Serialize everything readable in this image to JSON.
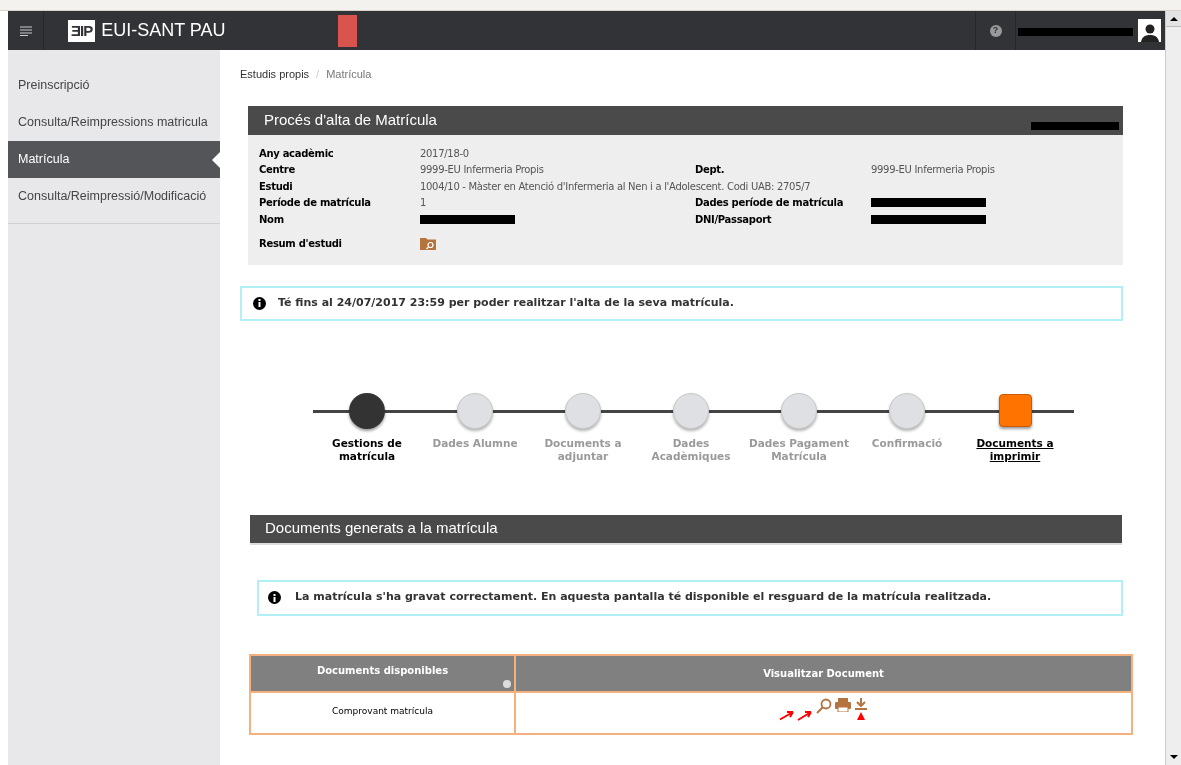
{
  "topbar": {
    "logo_mark": "ƎIP",
    "brand": "EUI-SANT PAU",
    "help": "?"
  },
  "sidebar": {
    "items": [
      {
        "label": "Preinscripció",
        "selected": false
      },
      {
        "label": "Consulta/Reimpressions matricula",
        "selected": false
      },
      {
        "label": "Matrícula",
        "selected": true
      },
      {
        "label": "Consulta/Reimpressió/Modificació",
        "selected": false
      }
    ]
  },
  "breadcrumb": [
    "Estudis propis",
    "/",
    "Matrícula"
  ],
  "enrolment_card": {
    "title": "Procés d'alta de Matrícula",
    "fields": [
      {
        "label": "Any acadèmic",
        "value": "2017/18-0"
      },
      {
        "label": "Centre",
        "value": "9999-EU Infermeria Propis",
        "label_2": "Dept.",
        "value_2": "9999-EU Infermeria Propis"
      },
      {
        "label": "Estudi",
        "value": "1004/10 - Màster en Atenció d'Infermeria al Nen i a l'Adolescent. Codi UAB: 2705/7"
      },
      {
        "label": "Període de matrícula",
        "value": "1",
        "label_2": "Dades període de matrícula",
        "redacted_2": true
      },
      {
        "label": "Nom",
        "redacted": true,
        "label_2": "DNI/Passaport",
        "redacted_2": true
      }
    ],
    "summary_label": "Resum d'estudi"
  },
  "deadline_notice": "Té fins al 24/07/2017 23:59 per poder realitzar l'alta de la seva matrícula.",
  "steps": [
    {
      "label": "Gestions de matrícula",
      "kind": "done"
    },
    {
      "label": "Dades Alumne",
      "kind": "pending"
    },
    {
      "label": "Documents a adjuntar",
      "kind": "pending"
    },
    {
      "label": "Dades Acadèmiques",
      "kind": "pending"
    },
    {
      "label": "Dades Pagament Matrícula",
      "kind": "pending"
    },
    {
      "label": "Confirmació",
      "kind": "pending"
    },
    {
      "label": "Documents a imprimir",
      "kind": "current"
    }
  ],
  "documents": {
    "title": "Documents generats a la matrícula",
    "notice": "La matrícula s'ha gravat correctament. En aquesta pantalla té disponible el resguard de la matrícula realitzada.",
    "columns": [
      "Documents disponibles",
      "Visualitzar Document"
    ],
    "rows": [
      {
        "name": "Comprovant matrícula"
      }
    ]
  }
}
